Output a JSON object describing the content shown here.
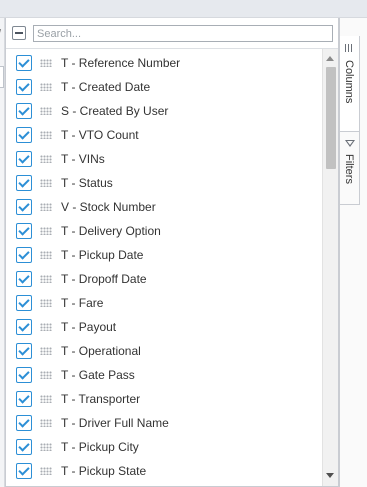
{
  "search": {
    "placeholder": "Search..."
  },
  "columns": [
    {
      "label": "T - Reference Number",
      "checked": true
    },
    {
      "label": "T - Created Date",
      "checked": true
    },
    {
      "label": "S - Created By User",
      "checked": true
    },
    {
      "label": "T - VTO Count",
      "checked": true
    },
    {
      "label": "T - VINs",
      "checked": true
    },
    {
      "label": "T - Status",
      "checked": true
    },
    {
      "label": "V - Stock Number",
      "checked": true
    },
    {
      "label": "T - Delivery Option",
      "checked": true
    },
    {
      "label": "T - Pickup Date",
      "checked": true
    },
    {
      "label": "T - Dropoff Date",
      "checked": true
    },
    {
      "label": "T - Fare",
      "checked": true
    },
    {
      "label": "T - Payout",
      "checked": true
    },
    {
      "label": "T - Operational",
      "checked": true
    },
    {
      "label": "T - Gate Pass",
      "checked": true
    },
    {
      "label": "T - Transporter",
      "checked": true
    },
    {
      "label": "T - Driver Full Name",
      "checked": true
    },
    {
      "label": "T - Pickup City",
      "checked": true
    },
    {
      "label": "T - Pickup State",
      "checked": true
    }
  ],
  "side_tabs": {
    "columns": "Columns",
    "filters": "Filters"
  },
  "colors": {
    "checkbox": "#2c8fd6",
    "border": "#c9ccd2"
  },
  "icons": {
    "columns": "columns-icon",
    "filters": "filter-icon",
    "drag": "drag-handle-icon"
  }
}
